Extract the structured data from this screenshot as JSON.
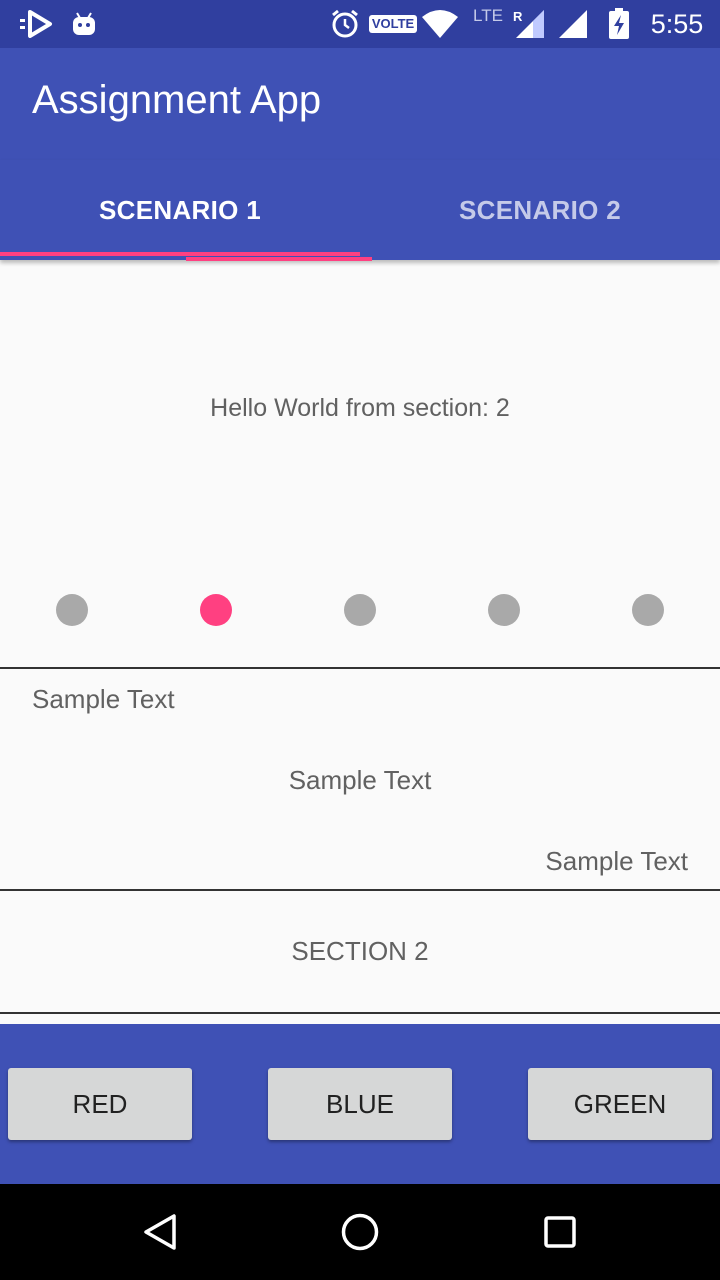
{
  "status_bar": {
    "time": "5:55",
    "volte_label": "VOLTE",
    "network_label": "LTE",
    "roaming_label": "R",
    "icons": [
      "play-store-icon",
      "android-icon",
      "alarm-icon",
      "volte-icon",
      "wifi-icon",
      "signal-icon",
      "signal-icon",
      "battery-charging-icon"
    ]
  },
  "app_bar": {
    "title": "Assignment App"
  },
  "tabs": [
    {
      "label": "SCENARIO 1",
      "selected": true
    },
    {
      "label": "SCENARIO 2",
      "selected": false
    }
  ],
  "content": {
    "hello_text": "Hello World from section: 2",
    "page_indicator": {
      "count": 5,
      "active_index": 1
    },
    "sample_texts": [
      "Sample Text",
      "Sample Text",
      "Sample Text"
    ],
    "section_label": "SECTION 2"
  },
  "buttons": [
    {
      "label": "RED"
    },
    {
      "label": "BLUE"
    },
    {
      "label": "GREEN"
    }
  ],
  "nav_bar": {
    "icons": [
      "back-icon",
      "home-icon",
      "recents-icon"
    ]
  },
  "colors": {
    "primary": "#3f51b5",
    "primary_dark": "#303f9f",
    "accent": "#ff4081",
    "dot_inactive": "#a9a9a9",
    "button_bg": "#d6d7d7"
  }
}
